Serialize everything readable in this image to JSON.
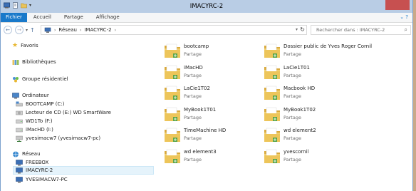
{
  "window": {
    "title": "IMACYRC-2"
  },
  "ribbon": {
    "tabs": [
      "Fichier",
      "Accueil",
      "Partage",
      "Affichage"
    ]
  },
  "address": {
    "crumbs": [
      "Réseau",
      "IMACYRC-2"
    ]
  },
  "search": {
    "placeholder": "Rechercher dans : IMACYRC-2"
  },
  "nav": {
    "favorites": "Favoris",
    "libraries": "Bibliothèques",
    "homegroup": "Groupe résidentiel",
    "computer": "Ordinateur",
    "drives": [
      "BOOTCAMP (C:)",
      "Lecteur de CD (E:) WD SmartWare",
      "WD1To (F:)",
      "iMacHD (I:)",
      "yvesimacw7 (yvesimacw7-pc)"
    ],
    "network": "Réseau",
    "network_items": [
      "FREEBOX",
      "IMACYRC-2",
      "YVESIMACW7-PC"
    ]
  },
  "shares": [
    {
      "name": "bootcamp",
      "type": "Partage"
    },
    {
      "name": "Dossier public de Yves Roger Cornil",
      "type": "Partage"
    },
    {
      "name": "iMacHD",
      "type": "Partage"
    },
    {
      "name": "LaCie1T01",
      "type": "Partage"
    },
    {
      "name": "LaCie1T02",
      "type": "Partage"
    },
    {
      "name": "Macbook HD",
      "type": "Partage"
    },
    {
      "name": "MyBook1T01",
      "type": "Partage"
    },
    {
      "name": "MyBook1T02",
      "type": "Partage"
    },
    {
      "name": "TimeMachine HD",
      "type": "Partage"
    },
    {
      "name": "wd element2",
      "type": "Partage"
    },
    {
      "name": "wd element3",
      "type": "Partage"
    },
    {
      "name": "yvescornil",
      "type": "Partage"
    }
  ],
  "colors": {
    "accent": "#1979ca",
    "titlebar": "#b9cde5",
    "selection": "#e5f3fb",
    "folder": "#e8c35a"
  }
}
